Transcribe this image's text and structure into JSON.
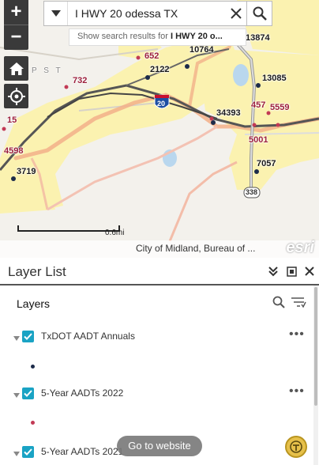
{
  "search": {
    "query": "I HWY 20 odessa TX",
    "suggestion_prefix": "Show search results for ",
    "suggestion_term": "I HWY 20 o..."
  },
  "map": {
    "zoom_in": "+",
    "zoom_out": "−",
    "labels": {
      "l_13874": "13874",
      "l_10764": "10764",
      "l_652": "652",
      "l_2122": "2122",
      "l_732": "732",
      "l_13085": "13085",
      "l_457": "457",
      "l_5559": "5559",
      "l_34393": "34393",
      "l_15": "15",
      "l_4598": "4598",
      "l_5001": "5001",
      "l_7057": "7057",
      "l_3719": "3719",
      "l_pst": "P S T"
    },
    "shields": {
      "interstate": "20",
      "route": "338"
    },
    "scale_label": "0.6mi",
    "attribution": "City of Midland, Bureau of ...",
    "esri_logo": "esri"
  },
  "panel": {
    "title": "Layer List",
    "layers_header": "Layers",
    "layers": [
      {
        "name": "TxDOT AADT Annuals",
        "checked": true,
        "more": "•••"
      },
      {
        "name": "5-Year AADTs 2022",
        "checked": true,
        "more": "•••"
      },
      {
        "name": "5-Year AADTs 2021",
        "checked": true
      }
    ]
  },
  "toast": "Go to website",
  "colors": {
    "accent": "#1aa3c4",
    "map_button": "#3a3a3a",
    "label_red": "#9c1f3c",
    "zone_yellow": "#fbf2b0",
    "route_orange": "#f2b089"
  }
}
